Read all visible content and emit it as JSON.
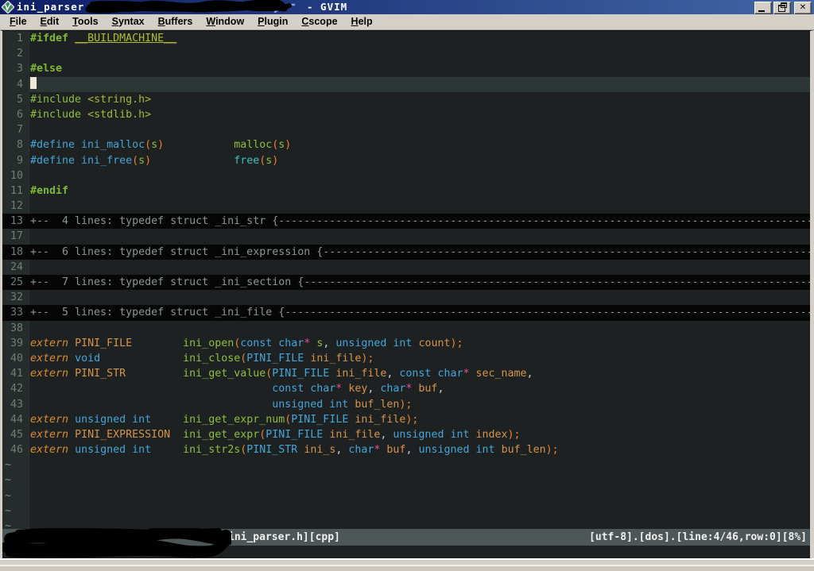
{
  "window": {
    "title_file": "ini_parser.h",
    "title_suffix": "- GVIM",
    "icons": {
      "app": "vim-logo",
      "minimize": "_",
      "restore": "❐",
      "close": "✕"
    }
  },
  "menu": {
    "items": [
      {
        "label": "File",
        "ul": 0
      },
      {
        "label": "Edit",
        "ul": 0
      },
      {
        "label": "Tools",
        "ul": 0
      },
      {
        "label": "Syntax",
        "ul": 0
      },
      {
        "label": "Buffers",
        "ul": 0
      },
      {
        "label": "Window",
        "ul": 0
      },
      {
        "label": "Plugin",
        "ul": 0
      },
      {
        "label": "Cscope",
        "ul": 0
      },
      {
        "label": "Help",
        "ul": 0
      }
    ]
  },
  "editor": {
    "tilde_rows": 5,
    "tilde_char": "~",
    "fold_dashes": "----------------------------------------------------------------------------------------------------------------------------------------",
    "lines": [
      {
        "num": 1,
        "kind": "code",
        "segs": [
          [
            "gb",
            "#ifdef"
          ],
          [
            "fg",
            " "
          ],
          [
            "mc",
            "__BUILDMACHINE__"
          ]
        ]
      },
      {
        "num": 2,
        "kind": "code",
        "segs": []
      },
      {
        "num": 3,
        "kind": "code",
        "segs": [
          [
            "gb",
            "#else"
          ]
        ]
      },
      {
        "num": 4,
        "kind": "cursor",
        "segs": []
      },
      {
        "num": 5,
        "kind": "code",
        "segs": [
          [
            "g",
            "#include "
          ],
          [
            "ol",
            "<string.h>"
          ]
        ]
      },
      {
        "num": 6,
        "kind": "code",
        "segs": [
          [
            "g",
            "#include "
          ],
          [
            "ol",
            "<stdlib.h>"
          ]
        ]
      },
      {
        "num": 7,
        "kind": "code",
        "segs": []
      },
      {
        "num": 8,
        "kind": "code",
        "segs": [
          [
            "cy",
            "#define ini_malloc"
          ],
          [
            "or",
            "("
          ],
          [
            "g",
            "s"
          ],
          [
            "or",
            ")"
          ],
          [
            "fg",
            "           "
          ],
          [
            "g",
            "malloc"
          ],
          [
            "or",
            "("
          ],
          [
            "g",
            "s"
          ],
          [
            "or",
            ")"
          ]
        ]
      },
      {
        "num": 9,
        "kind": "code",
        "segs": [
          [
            "cy",
            "#define ini_free"
          ],
          [
            "or",
            "("
          ],
          [
            "g",
            "s"
          ],
          [
            "or",
            ")"
          ],
          [
            "fg",
            "             "
          ],
          [
            "te",
            "free"
          ],
          [
            "or",
            "("
          ],
          [
            "g",
            "s"
          ],
          [
            "or",
            ")"
          ]
        ]
      },
      {
        "num": 10,
        "kind": "code",
        "segs": []
      },
      {
        "num": 11,
        "kind": "code",
        "segs": [
          [
            "gb",
            "#endif"
          ]
        ]
      },
      {
        "num": 12,
        "kind": "code",
        "segs": []
      },
      {
        "num": 13,
        "kind": "fold",
        "text": "+--  4 lines: typedef struct _ini_str {"
      },
      {
        "num": 17,
        "kind": "code",
        "segs": []
      },
      {
        "num": 18,
        "kind": "fold",
        "text": "+--  6 lines: typedef struct _ini_expression {"
      },
      {
        "num": 24,
        "kind": "code",
        "segs": []
      },
      {
        "num": 25,
        "kind": "fold",
        "text": "+--  7 lines: typedef struct _ini_section {"
      },
      {
        "num": 32,
        "kind": "code",
        "segs": []
      },
      {
        "num": 33,
        "kind": "fold",
        "text": "+--  5 lines: typedef struct _ini_file {"
      },
      {
        "num": 38,
        "kind": "code",
        "segs": []
      },
      {
        "num": 39,
        "kind": "code",
        "segs": [
          [
            "ex",
            "extern"
          ],
          [
            "fg",
            " "
          ],
          [
            "am",
            "PINI_FILE"
          ],
          [
            "fg",
            "        "
          ],
          [
            "g",
            "ini_open"
          ],
          [
            "or",
            "("
          ],
          [
            "cy",
            "const char"
          ],
          [
            "pk",
            "*"
          ],
          [
            "fg",
            " "
          ],
          [
            "g",
            "s"
          ],
          [
            "fg",
            ", "
          ],
          [
            "cy",
            "unsigned int"
          ],
          [
            "fg",
            " "
          ],
          [
            "am",
            "count"
          ],
          [
            "or",
            ");"
          ]
        ]
      },
      {
        "num": 40,
        "kind": "code",
        "segs": [
          [
            "ex",
            "extern"
          ],
          [
            "fg",
            " "
          ],
          [
            "cy",
            "void"
          ],
          [
            "fg",
            "             "
          ],
          [
            "g",
            "ini_close"
          ],
          [
            "or",
            "("
          ],
          [
            "cy",
            "PINI_FILE"
          ],
          [
            "fg",
            " "
          ],
          [
            "am",
            "ini_file"
          ],
          [
            "or",
            ");"
          ]
        ]
      },
      {
        "num": 41,
        "kind": "code",
        "segs": [
          [
            "ex",
            "extern"
          ],
          [
            "fg",
            " "
          ],
          [
            "am",
            "PINI_STR"
          ],
          [
            "fg",
            "         "
          ],
          [
            "g",
            "ini_get_value"
          ],
          [
            "or",
            "("
          ],
          [
            "cy",
            "PINI_FILE"
          ],
          [
            "fg",
            " "
          ],
          [
            "am",
            "ini_file"
          ],
          [
            "fg",
            ", "
          ],
          [
            "cy",
            "const char"
          ],
          [
            "pk",
            "*"
          ],
          [
            "fg",
            " "
          ],
          [
            "am",
            "sec_name"
          ],
          [
            "fg",
            ","
          ]
        ]
      },
      {
        "num": 42,
        "kind": "code",
        "segs": [
          [
            "fg",
            "                                      "
          ],
          [
            "cy",
            "const char"
          ],
          [
            "pk",
            "*"
          ],
          [
            "fg",
            " "
          ],
          [
            "am",
            "key"
          ],
          [
            "fg",
            ", "
          ],
          [
            "cy",
            "char"
          ],
          [
            "pk",
            "*"
          ],
          [
            "fg",
            " "
          ],
          [
            "am",
            "buf"
          ],
          [
            "fg",
            ","
          ]
        ]
      },
      {
        "num": 43,
        "kind": "code",
        "segs": [
          [
            "fg",
            "                                      "
          ],
          [
            "cy",
            "unsigned int"
          ],
          [
            "fg",
            " "
          ],
          [
            "am",
            "buf_len"
          ],
          [
            "or",
            ");"
          ]
        ]
      },
      {
        "num": 44,
        "kind": "code",
        "segs": [
          [
            "ex",
            "extern"
          ],
          [
            "fg",
            " "
          ],
          [
            "cy",
            "unsigned int"
          ],
          [
            "fg",
            "     "
          ],
          [
            "g",
            "ini_get_expr_num"
          ],
          [
            "or",
            "("
          ],
          [
            "cy",
            "PINI_FILE"
          ],
          [
            "fg",
            " "
          ],
          [
            "am",
            "ini_file"
          ],
          [
            "or",
            ");"
          ]
        ]
      },
      {
        "num": 45,
        "kind": "code",
        "segs": [
          [
            "ex",
            "extern"
          ],
          [
            "fg",
            " "
          ],
          [
            "am",
            "PINI_EXPRESSION"
          ],
          [
            "fg",
            "  "
          ],
          [
            "g",
            "ini_get_expr"
          ],
          [
            "or",
            "("
          ],
          [
            "cy",
            "PINI_FILE"
          ],
          [
            "fg",
            " "
          ],
          [
            "am",
            "ini_file"
          ],
          [
            "fg",
            ", "
          ],
          [
            "cy",
            "unsigned int"
          ],
          [
            "fg",
            " "
          ],
          [
            "am",
            "index"
          ],
          [
            "or",
            ");"
          ]
        ]
      },
      {
        "num": 46,
        "kind": "code",
        "segs": [
          [
            "ex",
            "extern"
          ],
          [
            "fg",
            " "
          ],
          [
            "cy",
            "unsigned int"
          ],
          [
            "fg",
            "     "
          ],
          [
            "g",
            "ini_str2s"
          ],
          [
            "or",
            "("
          ],
          [
            "cy",
            "PINI_STR"
          ],
          [
            "fg",
            " "
          ],
          [
            "am",
            "ini_s"
          ],
          [
            "fg",
            ", "
          ],
          [
            "cy",
            "char"
          ],
          [
            "pk",
            "*"
          ],
          [
            "fg",
            " "
          ],
          [
            "am",
            "buf"
          ],
          [
            "fg",
            ", "
          ],
          [
            "cy",
            "unsigned int"
          ],
          [
            "fg",
            " "
          ],
          [
            "am",
            "buf_len"
          ],
          [
            "or",
            ");"
          ]
        ]
      }
    ]
  },
  "statusbar": {
    "left": "ini_parser.h][cpp]",
    "right": "[utf-8].[dos].[line:4/46,row:0][8%]"
  },
  "palette": {
    "titlebar_left": "#0e1e66",
    "titlebar_right": "#4166a6",
    "menubar_bg": "#d4d0c8",
    "editor_bg": "#1d2121",
    "gutter_bg": "#262b2b",
    "fold_bg": "#060606",
    "fold_fg": "#8a9696",
    "line_number": "#6f7f76",
    "cursorline_bg": "#2c3634",
    "cursor": "#eee8d5",
    "status_bg": "#4d5757",
    "status_fg": "#f0f0f0",
    "syn_green": "#8fbe3f",
    "syn_olive": "#a8b832",
    "syn_macro": "#b3bd2d",
    "syn_cyan": "#45a5d8",
    "syn_teal": "#3fbfc4",
    "syn_orange": "#e8832d",
    "syn_amber": "#d59449",
    "syn_pink": "#e8509a",
    "syn_fg": "#c5cdcd"
  }
}
